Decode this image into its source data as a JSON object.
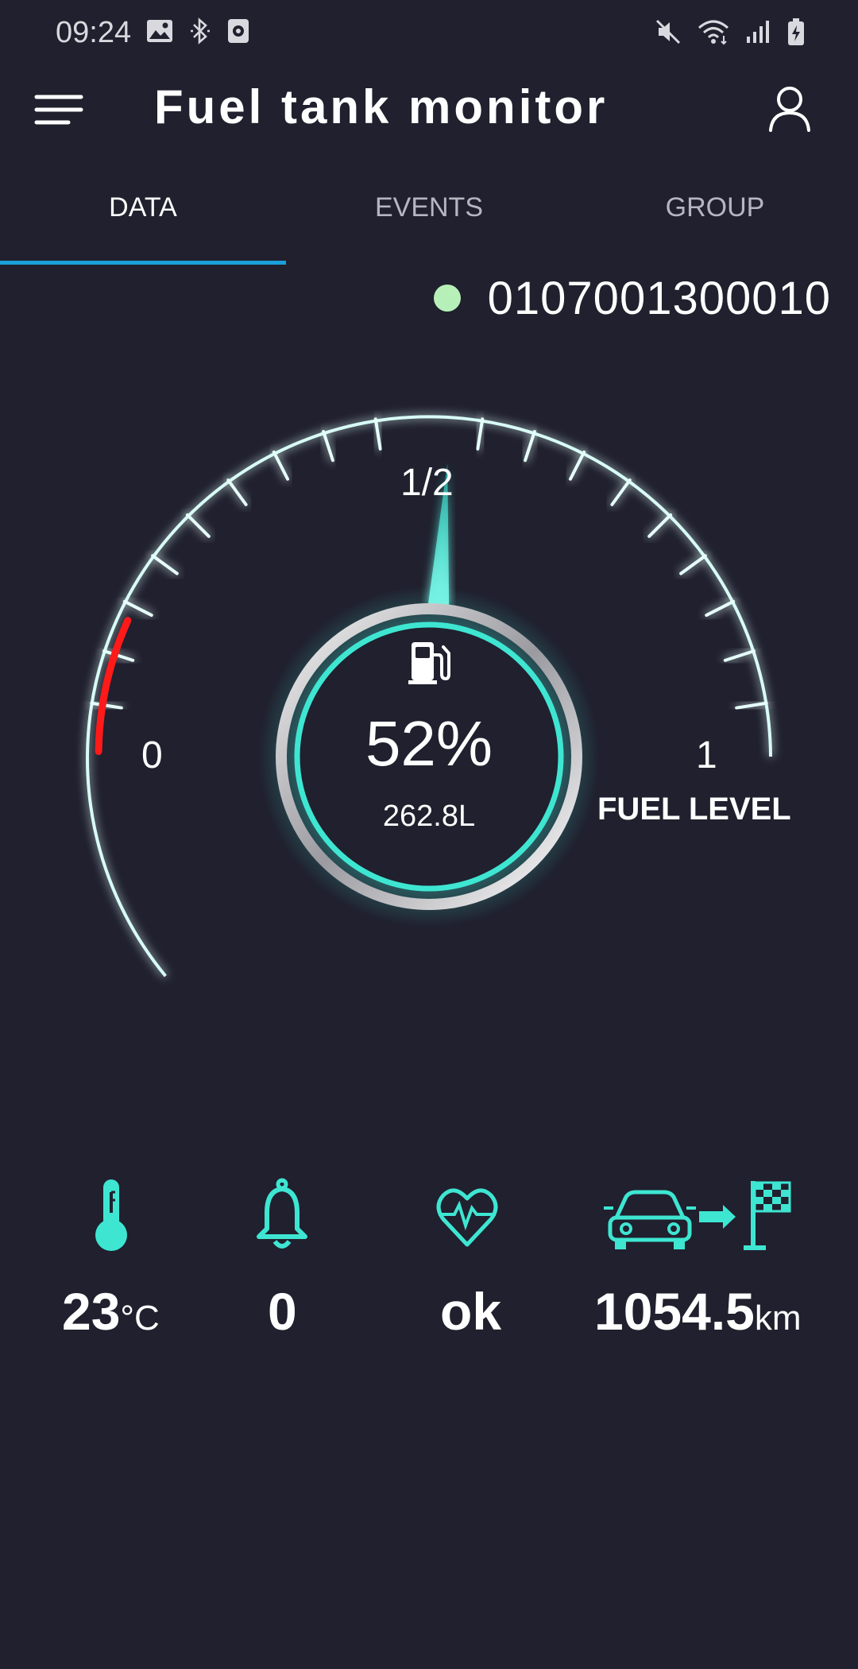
{
  "status_bar": {
    "time": "09:24",
    "left_icons": [
      "image-icon",
      "bluetooth-icon",
      "screen-record-icon"
    ],
    "right_icons": [
      "mute-icon",
      "wifi-icon",
      "signal-icon",
      "battery-charging-icon"
    ]
  },
  "app_bar": {
    "title": "Fuel tank monitor",
    "menu_icon": "menu-icon",
    "account_icon": "account-icon"
  },
  "tabs": [
    {
      "label": "DATA",
      "active": true
    },
    {
      "label": "EVENTS",
      "active": false
    },
    {
      "label": "GROUP",
      "active": false
    }
  ],
  "device": {
    "status": "online",
    "status_color": "#b6f0b8",
    "id": "0107001300010"
  },
  "gauge": {
    "tick_labels": {
      "min": "0",
      "mid": "1/2",
      "max": "1"
    },
    "caption": "FUEL LEVEL",
    "level_fraction": 0.52,
    "percent_text": "52%",
    "volume_text": "262.8L",
    "icon": "fuel-pump-icon",
    "accent_color": "#3ee6d2",
    "low_zone_color": "#ff1a1a"
  },
  "stats": [
    {
      "icon": "thermometer-icon",
      "value": "23",
      "unit": "°C"
    },
    {
      "icon": "bell-icon",
      "value": "0",
      "unit": ""
    },
    {
      "icon": "heart-pulse-icon",
      "value": "ok",
      "unit": ""
    },
    {
      "icon": "car-to-finish-icon",
      "value": "1054.5",
      "unit": "km"
    }
  ]
}
